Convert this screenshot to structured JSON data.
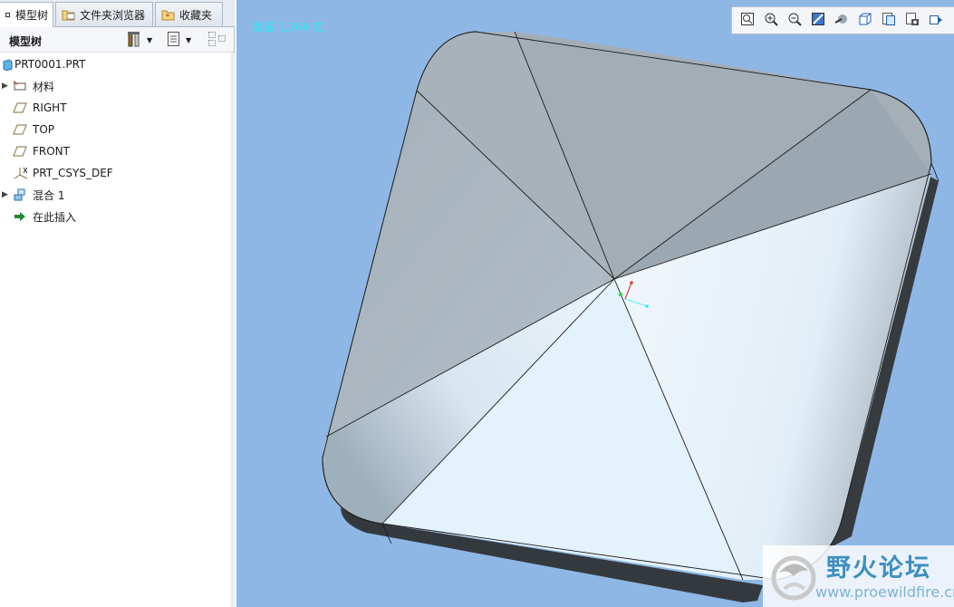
{
  "tabs": [
    {
      "label": "模型树"
    },
    {
      "label": "文件夹浏览器"
    },
    {
      "label": "收藏夹"
    }
  ],
  "tree_header": {
    "title": "模型树"
  },
  "tree": {
    "root": {
      "label": "PRT0001.PRT",
      "icon": "part-icon"
    },
    "items": [
      {
        "label": "材料",
        "icon": "material-icon",
        "expandable": true
      },
      {
        "label": "RIGHT",
        "icon": "datum-plane-icon",
        "expandable": false
      },
      {
        "label": "TOP",
        "icon": "datum-plane-icon",
        "expandable": false
      },
      {
        "label": "FRONT",
        "icon": "datum-plane-icon",
        "expandable": false
      },
      {
        "label": "PRT_CSYS_DEF",
        "icon": "coordinate-system-icon",
        "expandable": false
      },
      {
        "label": "混合 1",
        "icon": "blend-feature-icon",
        "expandable": true
      },
      {
        "label": "在此插入",
        "icon": "insert-here-arrow-icon",
        "expandable": false
      }
    ]
  },
  "viewport": {
    "weight_text": "重量 1,264 克",
    "background_color": "#8eb7e6"
  },
  "view_toolbar": [
    {
      "icon": "refit-icon"
    },
    {
      "icon": "zoom-in-icon"
    },
    {
      "icon": "zoom-out-icon"
    },
    {
      "icon": "repaint-icon"
    },
    {
      "icon": "display-style-icon"
    },
    {
      "icon": "saved-orientations-icon"
    },
    {
      "icon": "view-manager-icon"
    },
    {
      "icon": "datum-display-icon"
    },
    {
      "icon": "spin-center-icon"
    }
  ],
  "watermark": {
    "title": "野火论坛",
    "url": "www.proewildfire.cn",
    "logo": "proewildfire-logo"
  }
}
